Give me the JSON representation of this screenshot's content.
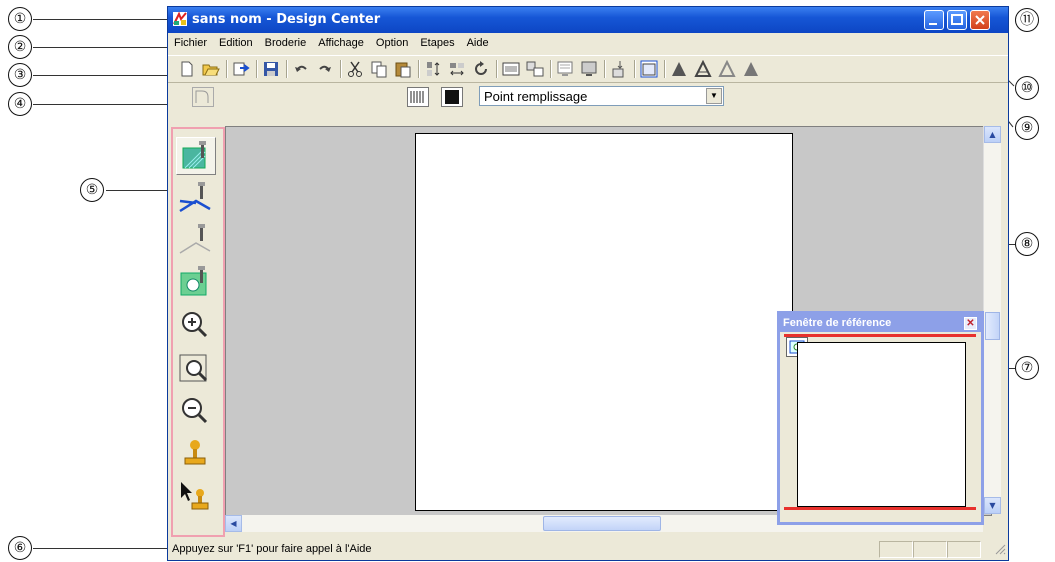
{
  "window": {
    "title": "sans nom - Design Center",
    "app_icon": "design-center-app-icon"
  },
  "menu": [
    "Fichier",
    "Edition",
    "Broderie",
    "Affichage",
    "Option",
    "Etapes",
    "Aide"
  ],
  "toolbar_icons": [
    "new-file-icon",
    "open-folder-icon",
    "import-icon",
    "save-icon",
    "undo-icon",
    "redo-icon",
    "cut-icon",
    "copy-icon",
    "paste-icon",
    "flip-vertical-icon",
    "flip-horizontal-icon",
    "rotate-icon",
    "page-properties-icon",
    "stitch-settings-icon",
    "design-center-page-icon",
    "layout-editing-icon",
    "write-to-card-icon",
    "reference-window-icon",
    "stage1-icon",
    "stage2-icon",
    "stage3-icon",
    "stage4-icon"
  ],
  "stitch_type": {
    "value": "Point remplissage"
  },
  "tools": [
    "fill-stitch-tool-icon",
    "line-stitch-tool-icon",
    "line-thin-tool-icon",
    "frame-stitch-tool-icon",
    "zoom-in-icon",
    "zoom-fit-icon",
    "zoom-out-icon",
    "stamp-icon",
    "select-stamp-icon"
  ],
  "status": {
    "text": "Appuyez sur 'F1' pour faire appel à l'Aide"
  },
  "reference_window": {
    "title": "Fenêtre de référence"
  },
  "callouts": [
    "①",
    "②",
    "③",
    "④",
    "⑤",
    "⑥",
    "⑦",
    "⑧",
    "⑨",
    "⑩",
    "⑪"
  ],
  "colors": {
    "titlebar": "#1656d6",
    "close": "#d2401c",
    "ref_border": "#8da0e8",
    "ref_red": "#e8312c"
  }
}
